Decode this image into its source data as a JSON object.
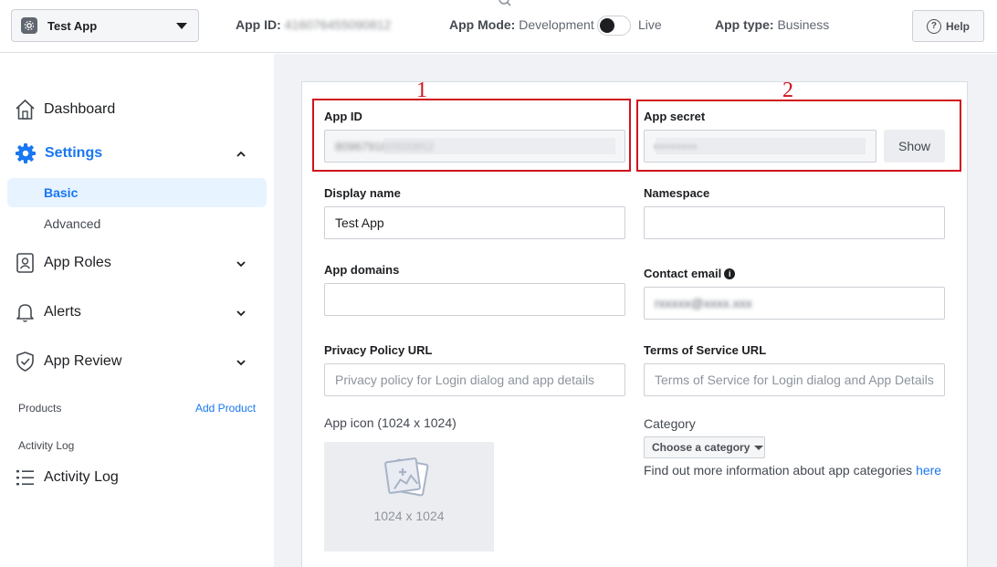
{
  "topbar": {
    "app_name": "Test App",
    "app_id_label": "App ID:",
    "app_id_value": "416076455090812",
    "app_mode_label": "App Mode:",
    "app_mode_value": "Development",
    "live_label": "Live",
    "app_type_label": "App type:",
    "app_type_value": "Business",
    "help_label": "Help"
  },
  "sidebar": {
    "dashboard": "Dashboard",
    "settings": "Settings",
    "basic": "Basic",
    "advanced": "Advanced",
    "app_roles": "App Roles",
    "alerts": "Alerts",
    "app_review": "App Review",
    "products_label": "Products",
    "add_product": "Add Product",
    "activity_log_label": "Activity Log",
    "activity_log": "Activity Log"
  },
  "form": {
    "app_id_label": "App ID",
    "app_id_value": "809679160500852",
    "app_secret_label": "App secret",
    "app_secret_value": "••••••••",
    "show_label": "Show",
    "display_name_label": "Display name",
    "display_name_value": "Test App",
    "namespace_label": "Namespace",
    "namespace_value": "",
    "app_domains_label": "App domains",
    "app_domains_value": "",
    "contact_email_label": "Contact email",
    "contact_email_value": "rxxxxx@xxxx.xxx",
    "privacy_label": "Privacy Policy URL",
    "privacy_placeholder": "Privacy policy for Login dialog and app details",
    "tos_label": "Terms of Service URL",
    "tos_placeholder": "Terms of Service for Login dialog and App Details",
    "app_icon_label": "App icon (1024 x 1024)",
    "app_icon_dims": "1024 x 1024",
    "category_label": "Category",
    "category_button": "Choose a category",
    "category_info": "Find out more information about app categories",
    "category_link": "here"
  },
  "annotations": {
    "box1_number": "1",
    "box2_number": "2",
    "color": "#d0121e"
  },
  "colors": {
    "accent": "#1877f2",
    "page_bg": "#f0f2f5",
    "active_bg": "#e7f3ff"
  }
}
